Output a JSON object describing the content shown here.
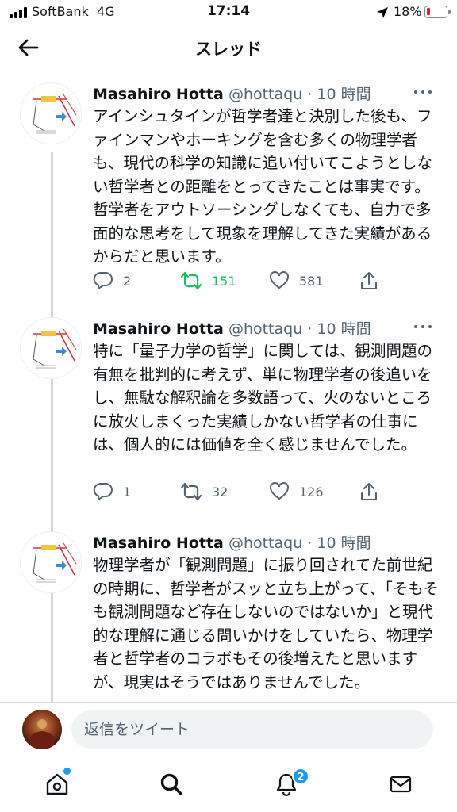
{
  "status_bar": {
    "carrier": "SoftBank",
    "network": "4G",
    "time": "17:14",
    "battery_percent": "18%",
    "battery_level": 0.18,
    "battery_color": "#e0242a"
  },
  "header": {
    "title": "スレッド",
    "back_icon": "arrow-left-icon"
  },
  "tweets": [
    {
      "name": "Masahiro Hotta",
      "handle": "@hottaqu",
      "time": "· 10 時間",
      "text": "アインシュタインが哲学者達と決別した後も、ファインマンやホーキングを含む多くの物理学者も、現代の科学の知識に追い付いてこようとしない哲学者との距離をとってきたことは事実です。哲学者をアウトソーシングしなくても、自力で多面的な思考をして現象を理解してきた実績があるからだと思います。",
      "replies": "2",
      "retweets": "151",
      "retweeted": true,
      "likes": "581"
    },
    {
      "name": "Masahiro Hotta",
      "handle": "@hottaqu",
      "time": "· 10 時間",
      "text": "特に「量子力学の哲学」に関しては、観測問題の有無を批判的に考えず、単に物理学者の後追いをし、無駄な解釈論を多数語って、火のないところに放火しまくった実績しかない哲学者の仕事には、個人的には価値を全く感じませんでした。",
      "replies": "1",
      "retweets": "32",
      "retweeted": false,
      "likes": "126"
    },
    {
      "name": "Masahiro Hotta",
      "handle": "@hottaqu",
      "time": "· 10 時間",
      "text": "物理学者が「観測問題」に振り回されてた前世紀の時期に、哲学者がスッと立ち上がって、「そもそも観測問題など存在しないのではないか」と現代的な理解に通じる問いかけをしていたら、物理学者と哲学者のコラボもその後増えたと思いますが、現実はそうではありませんでした。"
    }
  ],
  "reply_bar": {
    "placeholder": "返信をツイート"
  },
  "tab_bar": {
    "notification_badge": "2",
    "accent": "#1d9bf0"
  }
}
